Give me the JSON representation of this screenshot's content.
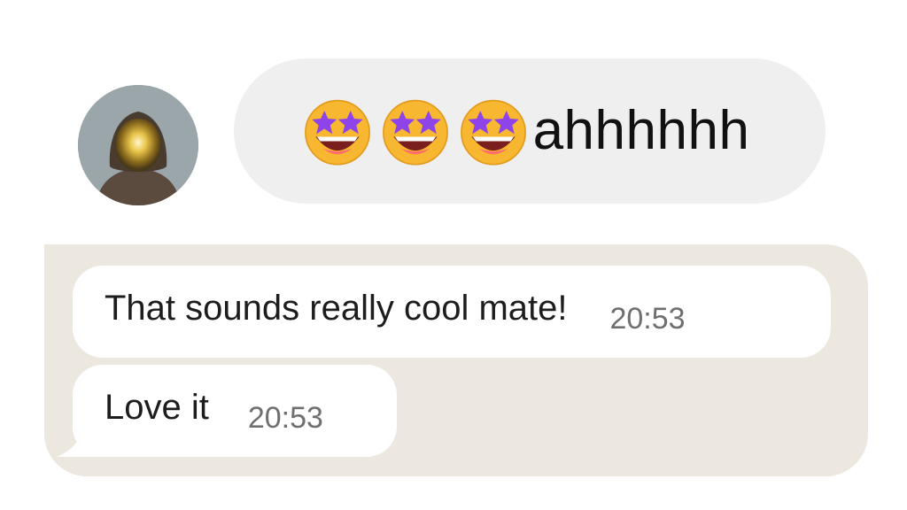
{
  "incoming": {
    "emojis": [
      "star-struck-emoji",
      "star-struck-emoji",
      "star-struck-emoji"
    ],
    "text": "ahhhhhh"
  },
  "outgoing": {
    "messages": [
      {
        "text": "That sounds really cool mate!",
        "time": "20:53"
      },
      {
        "text": "Love it",
        "time": "20:53"
      }
    ]
  },
  "colors": {
    "incoming_bubble": "#efeff0",
    "reply_container": "#ece8e0",
    "message_bubble": "#ffffff",
    "timestamp": "#6f6f6f"
  }
}
